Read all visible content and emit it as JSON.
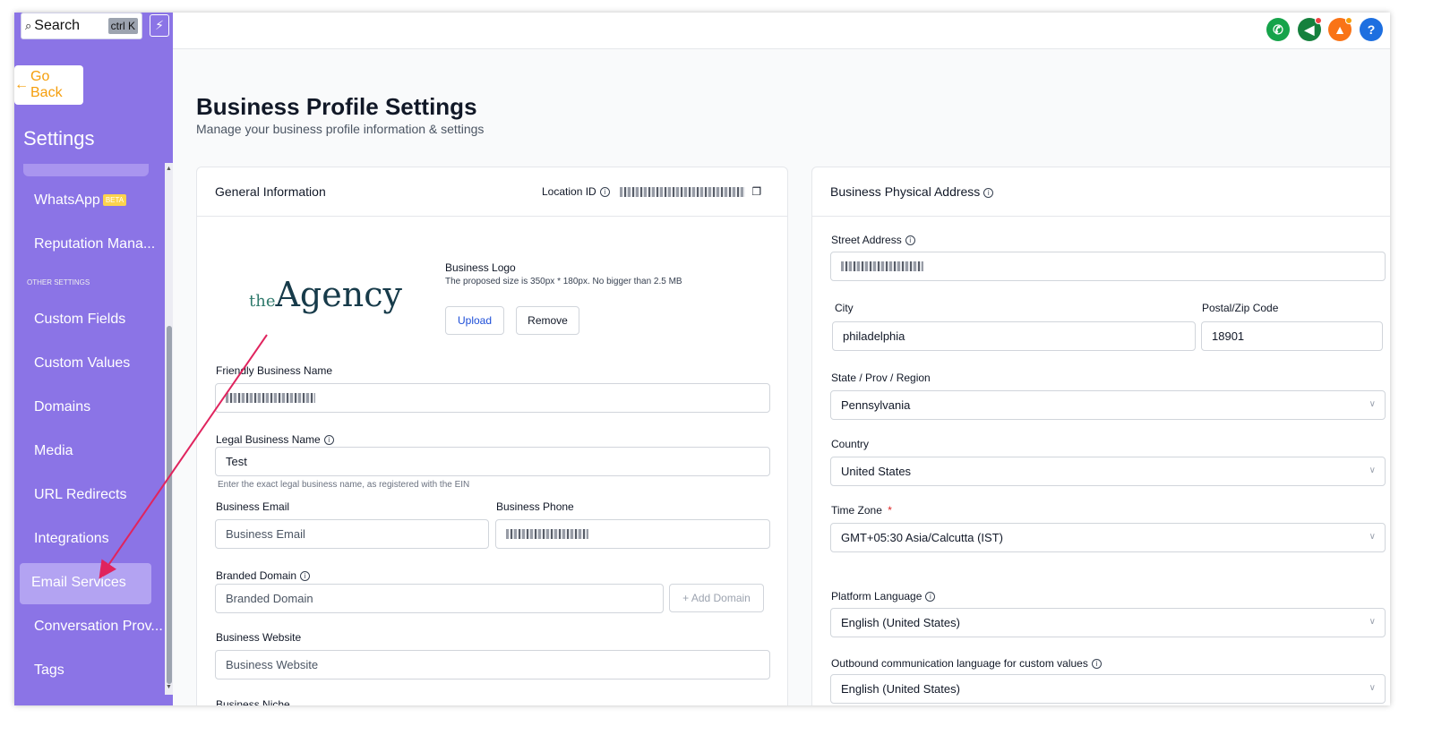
{
  "sidebar": {
    "search_label": "Search",
    "search_shortcut": "ctrl K",
    "go_back": "Go Back",
    "title": "Settings",
    "section_other": "OTHER SETTINGS",
    "beta_badge": "BETA",
    "items": [
      {
        "label": "WhatsApp"
      },
      {
        "label": "Reputation Mana..."
      },
      {
        "label": "Custom Fields"
      },
      {
        "label": "Custom Values"
      },
      {
        "label": "Domains"
      },
      {
        "label": "Media"
      },
      {
        "label": "URL Redirects"
      },
      {
        "label": "Integrations"
      },
      {
        "label": "Email Services"
      },
      {
        "label": "Conversation Prov..."
      },
      {
        "label": "Tags"
      }
    ],
    "active_item": "Email Services"
  },
  "topbar": {
    "icons": [
      "phone-icon",
      "megaphone-icon",
      "bell-icon",
      "help-icon"
    ],
    "colors": {
      "phone": "#16a34a",
      "megaphone": "#15803d",
      "bell": "#f97316",
      "help": "#1d6fe0"
    }
  },
  "page": {
    "title": "Business Profile Settings",
    "subtitle": "Manage your business profile information & settings"
  },
  "general": {
    "title": "General Information",
    "location_id_label": "Location ID",
    "logo_label": "Business Logo",
    "logo_help": "The proposed size is 350px * 180px. No bigger than 2.5 MB",
    "logo_text_the": "the",
    "logo_text_agency": "Agency",
    "upload": "Upload",
    "remove": "Remove",
    "friendly_name_label": "Friendly Business Name",
    "legal_name_label": "Legal Business Name",
    "legal_name_value": "Test",
    "legal_name_help": "Enter the exact legal business name, as registered with the EIN",
    "email_label": "Business Email",
    "email_placeholder": "Business Email",
    "phone_label": "Business Phone",
    "branded_domain_label": "Branded Domain",
    "branded_domain_placeholder": "Branded Domain",
    "add_domain": "+ Add Domain",
    "website_label": "Business Website",
    "website_placeholder": "Business Website",
    "niche_label": "Business Niche"
  },
  "address": {
    "title": "Business Physical Address",
    "street_label": "Street Address",
    "city_label": "City",
    "city_value": "philadelphia",
    "zip_label": "Postal/Zip Code",
    "zip_value": "18901",
    "state_label": "State / Prov / Region",
    "state_value": "Pennsylvania",
    "country_label": "Country",
    "country_value": "United States",
    "timezone_label": "Time Zone",
    "timezone_required": "*",
    "timezone_value": "GMT+05:30 Asia/Calcutta (IST)",
    "platform_lang_label": "Platform Language",
    "platform_lang_value": "English (United States)",
    "outbound_lang_label": "Outbound communication language for custom values",
    "outbound_lang_value": "English (United States)"
  }
}
